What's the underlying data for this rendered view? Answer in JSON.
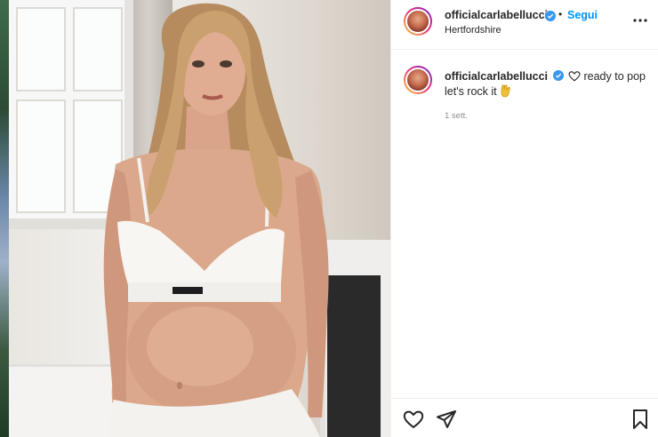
{
  "post": {
    "username": "officialcarlabellucci",
    "follow_label": "Segui",
    "separator": "•",
    "location": "Hertfordshire",
    "caption_text": "ready to pop let's rock it",
    "timestamp": "1 sett."
  },
  "icons": {
    "verified": "verified-badge-icon",
    "more": "more-options-icon",
    "heart": "heart-icon",
    "share": "send-icon",
    "save": "bookmark-icon"
  },
  "colors": {
    "accent": "#0095f6",
    "text": "#262626",
    "muted": "#8e8e8e",
    "border": "#efefef"
  }
}
